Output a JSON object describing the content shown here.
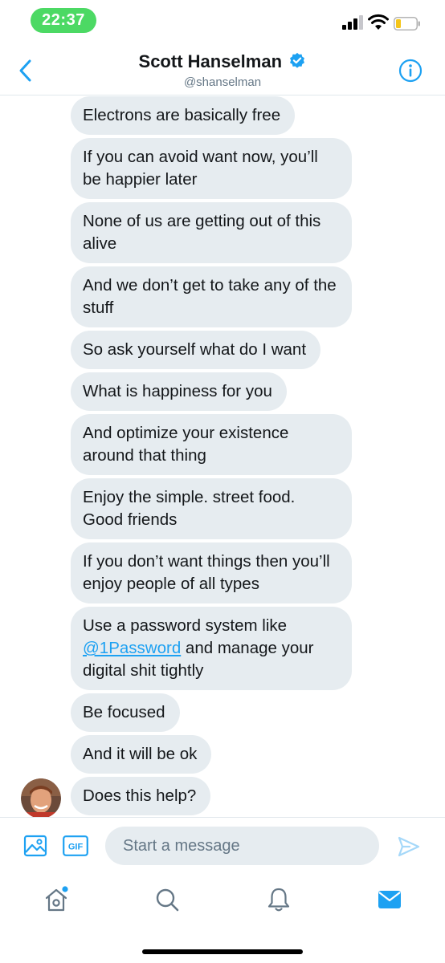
{
  "status_bar": {
    "time": "22:37"
  },
  "header": {
    "name": "Scott Hanselman",
    "handle": "@shanselman",
    "verified": true,
    "back_icon": "chevron-left-icon",
    "info_icon": "info-icon"
  },
  "messages": [
    {
      "text": "Electrons are basically free"
    },
    {
      "text": "If you can avoid want now, you’ll be happier later"
    },
    {
      "text": "None of us are getting out of this alive"
    },
    {
      "text": "And we don’t get to take any of the stuff"
    },
    {
      "text": "So ask yourself what do I want"
    },
    {
      "text": "What is happiness for you"
    },
    {
      "text": "And optimize your existence around that thing"
    },
    {
      "text": "Enjoy the simple. street food. Good friends"
    },
    {
      "text": "If you don’t want things then you’ll enjoy people of all types"
    },
    {
      "text_before": "Use a password system like ",
      "mention": "@1Password",
      "text_after": " and manage your digital shit tightly"
    },
    {
      "text": "Be focused"
    },
    {
      "text": "And it will be ok"
    },
    {
      "text": "Does this help?"
    }
  ],
  "composer": {
    "placeholder": "Start a message",
    "gif_label": "GIF",
    "image_icon": "image-icon",
    "send_icon": "send-icon"
  },
  "tab_bar": {
    "items": [
      {
        "name": "home",
        "icon": "home-icon",
        "has_badge": true
      },
      {
        "name": "search",
        "icon": "search-icon"
      },
      {
        "name": "notifications",
        "icon": "bell-icon"
      },
      {
        "name": "messages",
        "icon": "mail-icon",
        "active": true
      }
    ]
  },
  "colors": {
    "accent": "#1da1f2",
    "bubble": "#e6ecf0",
    "status_pill": "#4cd964",
    "battery_low": "#f5c518"
  }
}
